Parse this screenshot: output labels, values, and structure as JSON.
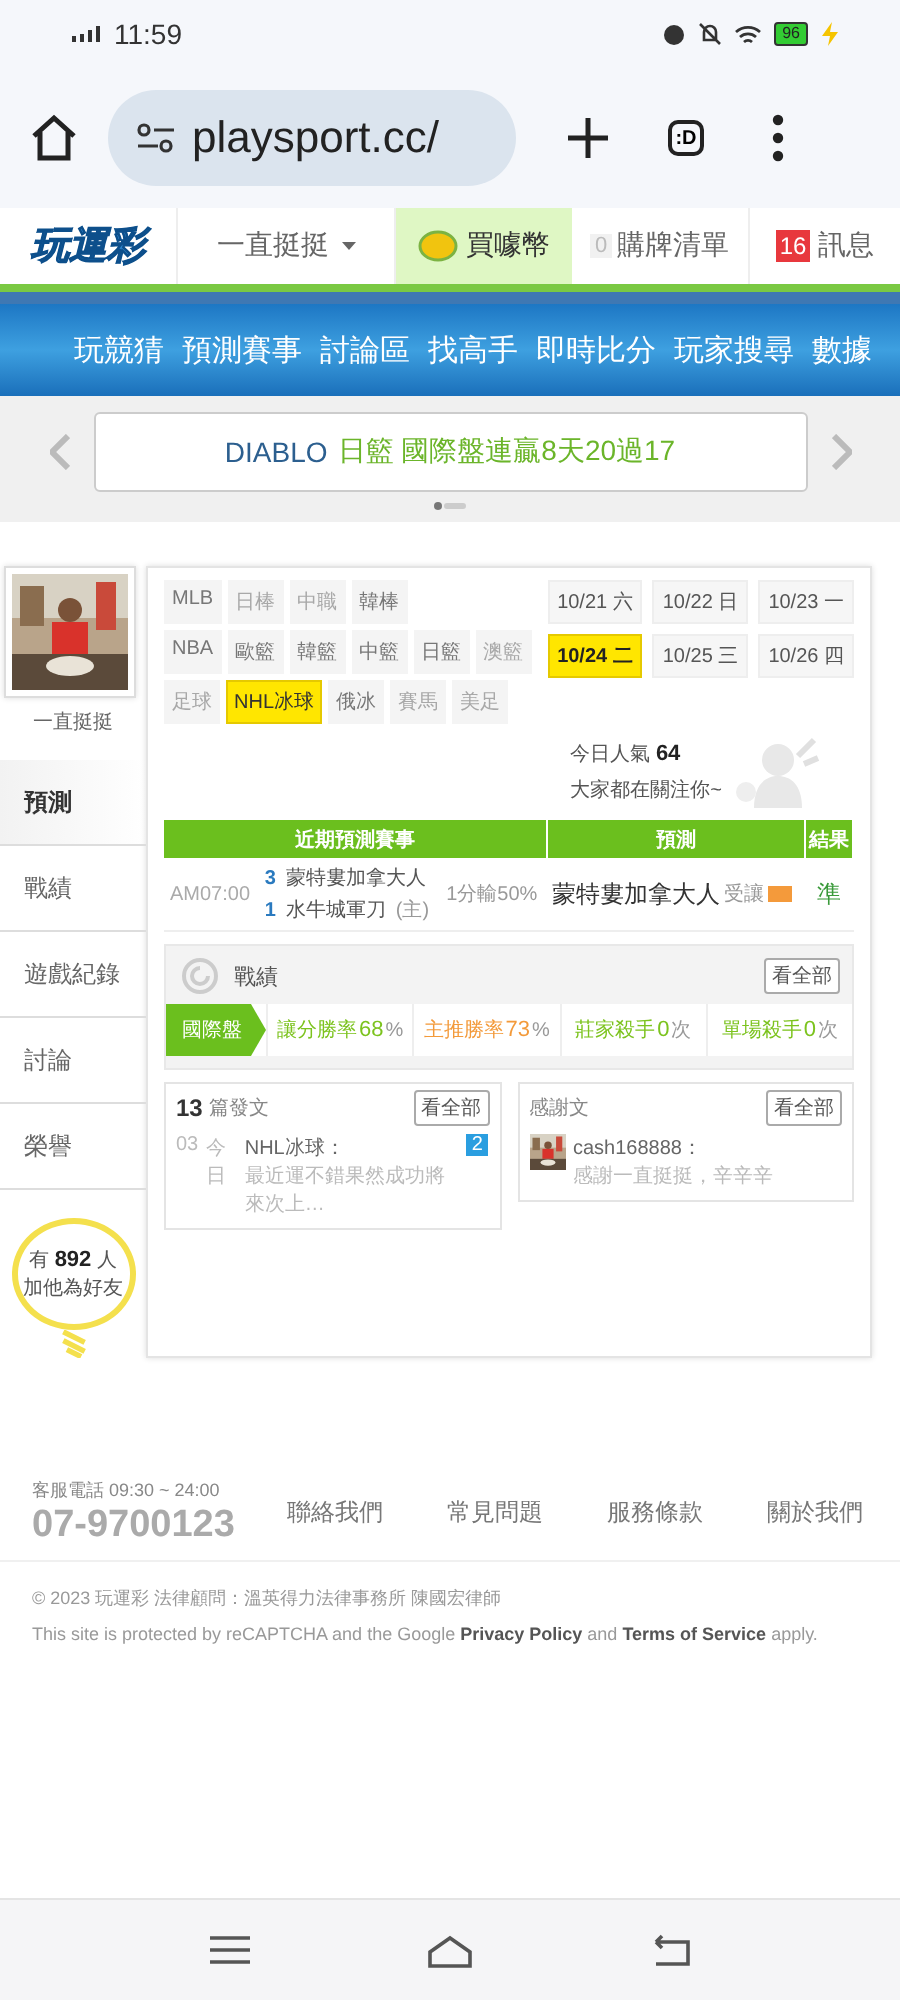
{
  "status_bar": {
    "time": "11:59",
    "battery": "96"
  },
  "browser": {
    "url": "playsport.cc/",
    "tab_label": ":D"
  },
  "site_header": {
    "logo": "玩運彩",
    "user": "一直挺挺",
    "coin": "買噱幣",
    "cart_count": "0",
    "cart": "購牌清單",
    "message_count": "16",
    "messages": "訊息"
  },
  "nav": [
    "玩競猜",
    "預測賽事",
    "討論區",
    "找高手",
    "即時比分",
    "玩家搜尋",
    "數據"
  ],
  "banner": {
    "team": "DIABLO",
    "headline": "日籃 國際盤連贏8天20過17"
  },
  "profile": {
    "name": "一直挺挺",
    "menu": [
      {
        "label": "預測",
        "selected": true
      },
      {
        "label": "戰績",
        "selected": false
      },
      {
        "label": "遊戲紀錄",
        "selected": false
      },
      {
        "label": "討論",
        "selected": false
      },
      {
        "label": "榮譽",
        "selected": false
      }
    ],
    "fans_prefix": "有",
    "fans": "892",
    "fans_unit": "人",
    "fans_caption": "加他為好友"
  },
  "sports": [
    [
      {
        "label": "MLB",
        "enabled": true,
        "selected": false
      },
      {
        "label": "日棒",
        "enabled": false,
        "selected": false
      },
      {
        "label": "中職",
        "enabled": false,
        "selected": false
      },
      {
        "label": "韓棒",
        "enabled": true,
        "selected": false
      }
    ],
    [
      {
        "label": "NBA",
        "enabled": true,
        "selected": false
      },
      {
        "label": "歐籃",
        "enabled": true,
        "selected": false
      },
      {
        "label": "韓籃",
        "enabled": true,
        "selected": false
      },
      {
        "label": "中籃",
        "enabled": true,
        "selected": false
      },
      {
        "label": "日籃",
        "enabled": true,
        "selected": false
      },
      {
        "label": "澳籃",
        "enabled": false,
        "selected": false
      }
    ],
    [
      {
        "label": "足球",
        "enabled": false,
        "selected": false
      },
      {
        "label": "NHL冰球",
        "enabled": true,
        "selected": true
      },
      {
        "label": "俄冰",
        "enabled": true,
        "selected": false
      },
      {
        "label": "賽馬",
        "enabled": false,
        "selected": false
      },
      {
        "label": "美足",
        "enabled": false,
        "selected": false
      }
    ]
  ],
  "dates": [
    {
      "label": "10/21 六",
      "selected": false
    },
    {
      "label": "10/22 日",
      "selected": false
    },
    {
      "label": "10/23 一",
      "selected": false
    },
    {
      "label": "10/24 二",
      "selected": true
    },
    {
      "label": "10/25 三",
      "selected": false
    },
    {
      "label": "10/26 四",
      "selected": false
    }
  ],
  "popularity": {
    "label": "今日人氣",
    "value": "64",
    "caption": "大家都在關注你~"
  },
  "predictions": {
    "columns": [
      "近期預測賽事",
      "預測",
      "結果"
    ],
    "rows": [
      {
        "time": "AM07:00",
        "away_score": "3",
        "away": "蒙特婁加拿大人",
        "home_score": "1",
        "home": "水牛城軍刀",
        "home_mark": "(主)",
        "line": "1分輸50%",
        "pick": "蒙特婁加拿大人",
        "pick_note": "受讓",
        "result": "準"
      }
    ]
  },
  "record": {
    "title": "戰績",
    "more": "看全部",
    "tab": "國際盤",
    "stats": [
      {
        "label": "讓分勝率",
        "value": "68",
        "unit": "%",
        "color": "#7cc31e"
      },
      {
        "label": "主推勝率",
        "value": "73",
        "unit": "%",
        "color": "#f39a3a"
      },
      {
        "label": "莊家殺手",
        "value": "0",
        "unit": "次",
        "color": "#7cc31e"
      },
      {
        "label": "單場殺手",
        "value": "0",
        "unit": "次",
        "color": "#7cc31e"
      }
    ]
  },
  "posts": {
    "count": "13",
    "title": "篇發文",
    "more": "看全部",
    "item": {
      "number": "03",
      "title": "NHL冰球：",
      "date": "今日",
      "excerpt": "最近運不錯果然成功將來次上…",
      "replies": "2"
    }
  },
  "thanks": {
    "title": "感謝文",
    "more": "看全部",
    "item": {
      "user": "cash168888：",
      "text": "感謝一直挺挺，辛辛辛"
    }
  },
  "footer": {
    "hours": "客服電話 09:30 ~ 24:00",
    "phone": "07-9700123",
    "links": [
      "聯絡我們",
      "常見問題",
      "服務條款",
      "關於我們"
    ],
    "copyright": "© 2023 玩運彩 法律顧問：溫英得力法律事務所 陳國宏律師",
    "recaptcha": "This site is protected by reCAPTCHA and the Google **Privacy Policy** and **Terms of Service** apply."
  }
}
